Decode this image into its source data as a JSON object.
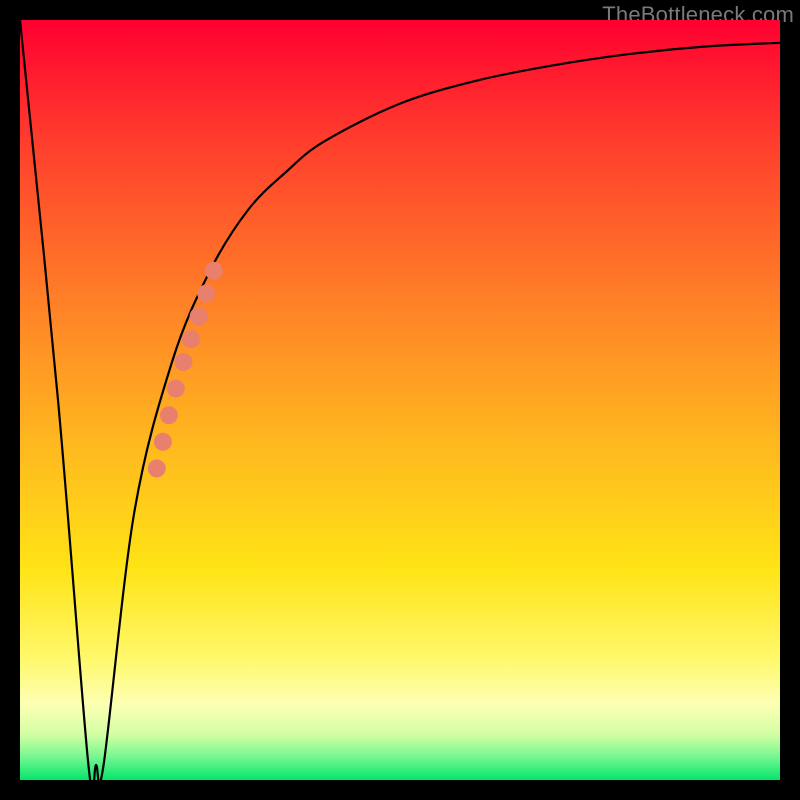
{
  "watermark": "TheBottleneck.com",
  "chart_data": {
    "type": "line",
    "title": "",
    "xlabel": "",
    "ylabel": "",
    "xlim": [
      0,
      100
    ],
    "ylim": [
      0,
      100
    ],
    "grid": false,
    "legend": false,
    "series": [
      {
        "name": "curve",
        "x": [
          0,
          5,
          9,
          10,
          11,
          15,
          20,
          25,
          30,
          35,
          40,
          50,
          60,
          70,
          80,
          90,
          100
        ],
        "y": [
          100,
          50,
          2,
          2,
          2,
          35,
          55,
          67,
          75,
          80,
          84,
          89,
          92,
          94,
          95.5,
          96.5,
          97
        ]
      }
    ],
    "highlight_dots": {
      "name": "salmon-dots",
      "color": "#e9806d",
      "points": [
        {
          "x": 18.0,
          "y": 41.0
        },
        {
          "x": 18.8,
          "y": 44.5
        },
        {
          "x": 19.6,
          "y": 48.0
        },
        {
          "x": 20.5,
          "y": 51.5
        },
        {
          "x": 21.5,
          "y": 55.0
        },
        {
          "x": 22.5,
          "y": 58.0
        },
        {
          "x": 23.5,
          "y": 61.0
        },
        {
          "x": 24.5,
          "y": 64.0
        },
        {
          "x": 25.5,
          "y": 67.0
        }
      ]
    }
  }
}
